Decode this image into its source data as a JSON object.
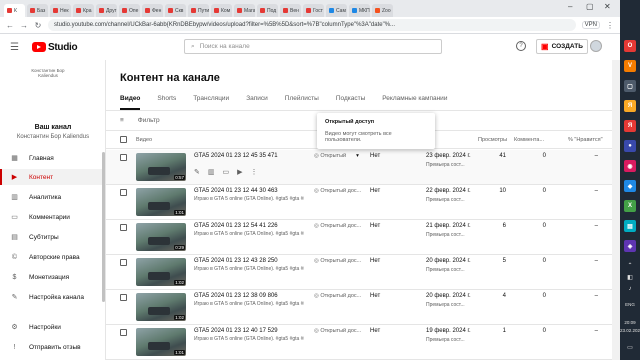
{
  "browser": {
    "tabs": [
      {
        "label": "К",
        "icon": "red"
      },
      {
        "label": "Баз",
        "icon": "red"
      },
      {
        "label": "Нек",
        "icon": "red"
      },
      {
        "label": "Кра",
        "icon": "red"
      },
      {
        "label": "Друг",
        "icon": "red"
      },
      {
        "label": "Опе",
        "icon": "red"
      },
      {
        "label": "Фен",
        "icon": "red"
      },
      {
        "label": "Скв",
        "icon": "red"
      },
      {
        "label": "Пути",
        "icon": "red"
      },
      {
        "label": "Ком",
        "icon": "red"
      },
      {
        "label": "Мага",
        "icon": "red"
      },
      {
        "label": "Под",
        "icon": "red"
      },
      {
        "label": "Вен",
        "icon": "red"
      },
      {
        "label": "Гост",
        "icon": "red"
      },
      {
        "label": "Сам",
        "icon": "blue"
      },
      {
        "label": "МКП",
        "icon": "blue"
      },
      {
        "label": "Zoo",
        "icon": "orange"
      }
    ],
    "url": "studio.youtube.com/channel/UCkBar-6abb{KRnDBEbypw/videos/upload?filter=%5B%5D&sort=%7B\"columnType\"%3A\"date\"%...",
    "vpn_label": "VPN"
  },
  "header": {
    "logo_text": "Studio",
    "search_placeholder": "Поиск на канале",
    "create_label": "СОЗДАТЬ"
  },
  "sidebar": {
    "channel_logo_text": "Константин Бор Kaliendus",
    "channel_title": "Ваш канал",
    "channel_name": "Константин Бор Kaliendus",
    "items": [
      {
        "label": "Главная",
        "icon": "dashboard-icon",
        "glyph": "▦"
      },
      {
        "label": "Контент",
        "icon": "content-icon",
        "glyph": "▶"
      },
      {
        "label": "Аналитика",
        "icon": "analytics-icon",
        "glyph": "▥"
      },
      {
        "label": "Комментарии",
        "icon": "comments-icon",
        "glyph": "▭"
      },
      {
        "label": "Субтитры",
        "icon": "subtitles-icon",
        "glyph": "▤"
      },
      {
        "label": "Авторские права",
        "icon": "copyright-icon",
        "glyph": "©"
      },
      {
        "label": "Монетизация",
        "icon": "monetization-icon",
        "glyph": "$"
      },
      {
        "label": "Настройка канала",
        "icon": "customization-icon",
        "glyph": "✎"
      },
      {
        "label": "Настройки",
        "icon": "settings-icon",
        "glyph": "⚙"
      },
      {
        "label": "Отправить отзыв",
        "icon": "feedback-icon",
        "glyph": "!"
      }
    ]
  },
  "main": {
    "title": "Контент на канале",
    "tabs": [
      "Видео",
      "Shorts",
      "Трансляции",
      "Записи",
      "Плейлисты",
      "Подкасты",
      "Рекламные кампании"
    ],
    "filter_label": "Фильтр",
    "columns": {
      "video": "Видео",
      "views": "Просмотры",
      "comments": "Коммента...",
      "likes": "% \"Нравится\""
    },
    "popup": {
      "title": "Открытый доступ",
      "text": "Видео могут смотреть все пользователи."
    },
    "rows": [
      {
        "title": "GTA5 2024 01 23 12 45 35 471",
        "desc": "",
        "duration": "0:57",
        "visibility": "Открытый",
        "restrictions": "Нет",
        "date": "23 февр. 2024 г.",
        "date_status": "Премьера сост...",
        "views": "41",
        "comments": "0",
        "likes": "–",
        "actions": true
      },
      {
        "title": "GTA5 2024 01 23 12 44 30 463",
        "desc": "Играю в GTA 5 online (GTA Online). #gta5 #gta #игры #GTA5 online #GTA Online #gta...",
        "duration": "1:01",
        "visibility": "Открытый дос...",
        "restrictions": "Нет",
        "date": "22 февр. 2024 г.",
        "date_status": "Премьера сост...",
        "views": "10",
        "comments": "0",
        "likes": "–",
        "actions": false
      },
      {
        "title": "GTA5 2024 01 23 12 54 41 226",
        "desc": "Играю в GTA 5 online (GTA Online). #gta5 #gta #игры #GTA5 online #GTA Online #gta...",
        "duration": "0:29",
        "visibility": "Открытый дос...",
        "restrictions": "Нет",
        "date": "21 февр. 2024 г.",
        "date_status": "Премьера сост...",
        "views": "6",
        "comments": "0",
        "likes": "–",
        "actions": false
      },
      {
        "title": "GTA5 2024 01 23 12 43 28 250",
        "desc": "Играю в GTA 5 online (GTA Online). #gta5 #gta #игры #GTA5 online #GTA Online #gta...",
        "duration": "1:02",
        "visibility": "Открытый дос...",
        "restrictions": "Нет",
        "date": "20 февр. 2024 г.",
        "date_status": "Премьера сост...",
        "views": "5",
        "comments": "0",
        "likes": "–",
        "actions": false
      },
      {
        "title": "GTA5 2024 01 23 12 38 09 806",
        "desc": "Играю в GTA 5 online (GTA Online). #gta5 #gta #игры #GTA5 online #GTA Online #gta...",
        "duration": "1:02",
        "visibility": "Открытый дос...",
        "restrictions": "Нет",
        "date": "20 февр. 2024 г.",
        "date_status": "Премьера сост...",
        "views": "4",
        "comments": "0",
        "likes": "–",
        "actions": false
      },
      {
        "title": "GTA5 2024 01 23 12 40 17 529",
        "desc": "Играю в GTA 5 online (GTA Online). #gta5 #gta #игры #GTA5 online #GTA Online #gta...",
        "duration": "1:01",
        "visibility": "Открытый дос...",
        "restrictions": "Нет",
        "date": "19 февр. 2024 г.",
        "date_status": "Премьера сост...",
        "views": "1",
        "comments": "0",
        "likes": "–",
        "actions": false
      }
    ]
  },
  "taskbar": {
    "lang": "ENG",
    "time": "20:09",
    "date": "23.02.2024"
  }
}
